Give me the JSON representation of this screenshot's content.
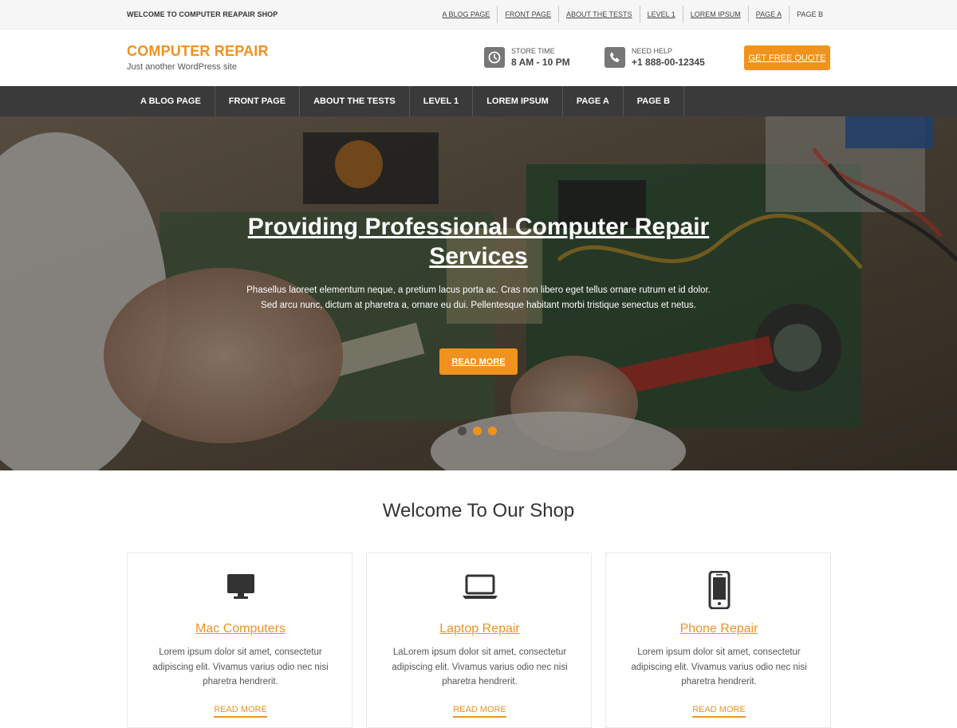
{
  "topbar": {
    "welcome": "WELCOME TO COMPUTER REAPAIR SHOP",
    "links": [
      "A BLOG PAGE",
      "FRONT PAGE",
      "ABOUT THE TESTS",
      "LEVEL 1",
      "LOREM IPSUM",
      "PAGE A",
      "PAGE B"
    ]
  },
  "header": {
    "site_title": "COMPUTER REPAIR",
    "tagline": "Just another WordPress site",
    "store_label": "STORE TIME",
    "store_value": "8 AM - 10 PM",
    "help_label": "NEED HELP",
    "help_value": "+1 888-00-12345",
    "quote_button": "GET FREE QUOTE"
  },
  "nav": {
    "items": [
      "A BLOG PAGE",
      "FRONT PAGE",
      "ABOUT THE TESTS",
      "LEVEL 1",
      "LOREM IPSUM",
      "PAGE A",
      "PAGE B"
    ]
  },
  "hero": {
    "title": "Providing Professional Computer Repair Services",
    "description": "Phasellus laoreet elementum neque, a pretium lacus porta ac. Cras non libero eget tellus ornare rutrum et id dolor. Sed arcu nunc, dictum at pharetra a, ornare eu dui. Pellentesque habitant morbi tristique senectus et netus.",
    "button": "READ MORE",
    "slide_count": 3,
    "active_slide": 2
  },
  "section": {
    "title": "Welcome To Our Shop",
    "cards": [
      {
        "icon": "monitor-icon",
        "title": "Mac Computers",
        "text": "Lorem ipsum dolor sit amet, consectetur adipiscing elit. Vivamus varius odio nec nisi pharetra hendrerit.",
        "link": "READ MORE"
      },
      {
        "icon": "laptop-icon",
        "title": "Laptop Repair",
        "text": "LaLorem ipsum dolor sit amet, consectetur adipiscing elit. Vivamus varius odio nec nisi pharetra hendrerit.",
        "link": "READ MORE"
      },
      {
        "icon": "phone-icon",
        "title": "Phone Repair",
        "text": "Lorem ipsum dolor sit amet, consectetur adipiscing elit. Vivamus varius odio nec nisi pharetra hendrerit.",
        "link": "READ MORE"
      }
    ]
  },
  "colors": {
    "accent": "#f0921e",
    "nav_bg": "#3a3a3a",
    "topbar_bg": "#f6f6f6"
  }
}
